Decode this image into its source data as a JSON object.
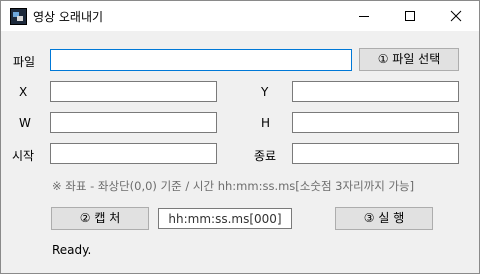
{
  "window": {
    "title": "영상 오래내기"
  },
  "title_bar_buttons": {
    "minimize_icon": "minimize-icon",
    "maximize_icon": "maximize-icon",
    "close_icon": "close-icon"
  },
  "form": {
    "file_label": "파일",
    "file_value": "",
    "select_file_button": "① 파일 선택",
    "x_label": "X",
    "x_value": "",
    "y_label": "Y",
    "y_value": "",
    "w_label": "W",
    "w_value": "",
    "h_label": "H",
    "h_value": "",
    "start_label": "시작",
    "start_value": "",
    "end_label": "종료",
    "end_value": ""
  },
  "note": "※ 좌표 - 좌상단(0,0) 기준 / 시간 hh:mm:ss.ms[소숫점 3자리까지 가능]",
  "actions": {
    "capture_button": "② 캡 처",
    "time_input_value": "hh:mm:ss.ms[000]",
    "run_button": "③ 실 행"
  },
  "status": "Ready.",
  "colors": {
    "focus_border": "#0078d7",
    "window_bg": "#f0f0f0"
  }
}
